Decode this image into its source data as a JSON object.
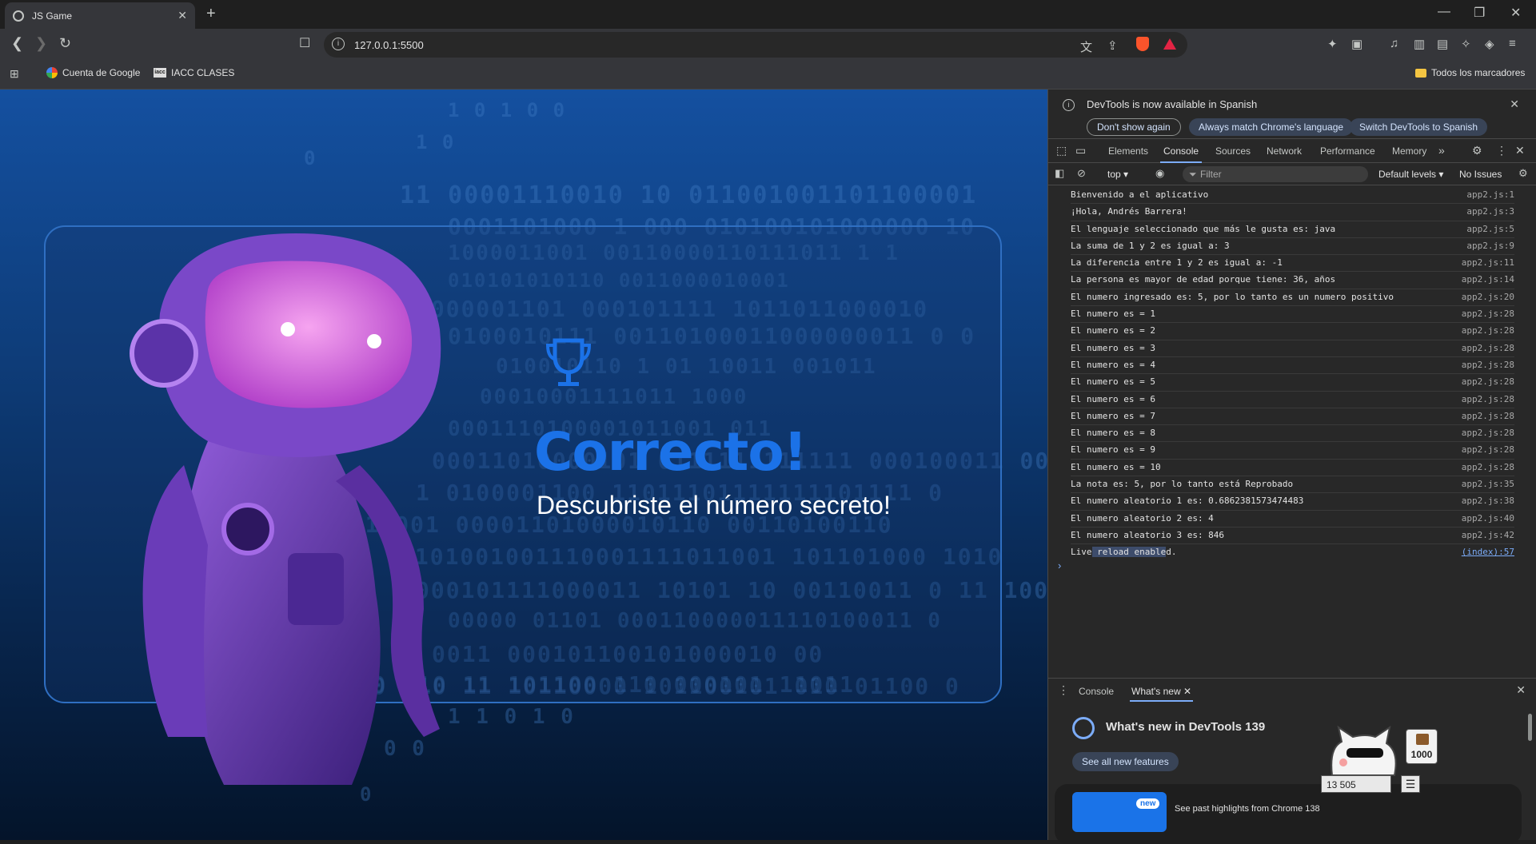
{
  "browser": {
    "tab_title": "JS Game",
    "url": "127.0.0.1:5500",
    "bookmarks": [
      {
        "label": "Cuenta de Google"
      },
      {
        "label": "IACC CLASES"
      }
    ],
    "all_bookmarks": "Todos los marcadores"
  },
  "game": {
    "headline": "Correcto!",
    "subtitle": "Descubriste el número secreto!",
    "binary_rows": [
      "1   0   1   0   0",
      "1                0",
      "0",
      "11 00001110010 10 011001001101100001",
      "0001101000 1   000 010100101000000 10",
      "1000011001 00110000110111011 1   1",
      "010101010110        0011000010001",
      "1000001101  000101111  1011011000010",
      "0100010111  00110100011000000011 0 0",
      "010010110    1 01 10011     001011",
      "00010001111011  1000",
      "0001110100001011001  011",
      "00011010000101 0111111111111 000100011 00",
      "1 0100001100  11011101111111101111    0",
      "01 11001 00001101000010110 00110100110",
      "0101001001110001111011001  101101000  1010",
      "000101111000011 10101 10 00110011 0 11 100",
      "00000 01101 000110000011110100011 0",
      "0011 000101100101000010 00",
      "10100 010 11 101100 110 000101 11011",
      "10100 010 11 10110000 101100101 010 01100 0",
      "1  1   0    1   0",
      "0    0",
      "0"
    ]
  },
  "devtools": {
    "infobar": {
      "message": "DevTools is now available in Spanish",
      "dont_show": "Don't show again",
      "match_language": "Always match Chrome's language",
      "switch_language": "Switch DevTools to Spanish"
    },
    "tabs": [
      "Elements",
      "Console",
      "Sources",
      "Network",
      "Performance",
      "Memory"
    ],
    "console_toolbar": {
      "context": "top",
      "filter_placeholder": "Filter",
      "levels": "Default levels",
      "issues": "No Issues"
    },
    "logs": [
      {
        "msg": "Bienvenido a el aplicativo",
        "src": "app2.js:1"
      },
      {
        "msg": "¡Hola, Andrés Barrera!",
        "src": "app2.js:3"
      },
      {
        "msg": "El lenguaje seleccionado que más le gusta es: java",
        "src": "app2.js:5"
      },
      {
        "msg": "La suma de 1 y 2 es igual a: 3",
        "src": "app2.js:9"
      },
      {
        "msg": "La diferencia entre 1 y 2 es igual a: -1",
        "src": "app2.js:11"
      },
      {
        "msg": "La persona es mayor de edad porque tiene: 36, años",
        "src": "app2.js:14"
      },
      {
        "msg": "El numero ingresado es: 5, por lo tanto es un numero positivo",
        "src": "app2.js:20"
      },
      {
        "msg": "El numero es = 1",
        "src": "app2.js:28"
      },
      {
        "msg": "El numero es = 2",
        "src": "app2.js:28"
      },
      {
        "msg": "El numero es = 3",
        "src": "app2.js:28"
      },
      {
        "msg": "El numero es = 4",
        "src": "app2.js:28"
      },
      {
        "msg": "El numero es = 5",
        "src": "app2.js:28"
      },
      {
        "msg": "El numero es = 6",
        "src": "app2.js:28"
      },
      {
        "msg": "El numero es = 7",
        "src": "app2.js:28"
      },
      {
        "msg": "El numero es = 8",
        "src": "app2.js:28"
      },
      {
        "msg": "El numero es = 9",
        "src": "app2.js:28"
      },
      {
        "msg": "El numero es = 10",
        "src": "app2.js:28"
      },
      {
        "msg": "La nota es: 5, por lo tanto está Reprobado",
        "src": "app2.js:35"
      },
      {
        "msg": "El numero aleatorio 1 es: 0.6862381573474483",
        "src": "app2.js:38"
      },
      {
        "msg": "El numero aleatorio 2 es: 4",
        "src": "app2.js:40"
      },
      {
        "msg": "El numero aleatorio 3 es: 846",
        "src": "app2.js:42"
      }
    ],
    "live_reload": {
      "pre": "Live",
      "hl": " reload enable",
      "post": "d.",
      "src": "(index):57"
    },
    "drawer": {
      "tab_console": "Console",
      "tab_whats_new": "What's new",
      "title": "What's new in DevTools 139",
      "see_all": "See all new features",
      "new_badge": "new",
      "past": "See past highlights from Chrome 138"
    }
  },
  "pet_widget": {
    "score": "1000",
    "counter": "13 505"
  },
  "colors": {
    "accent_blue": "#1b72e8",
    "devtools_bg": "#282828",
    "link": "#7cacf8"
  }
}
